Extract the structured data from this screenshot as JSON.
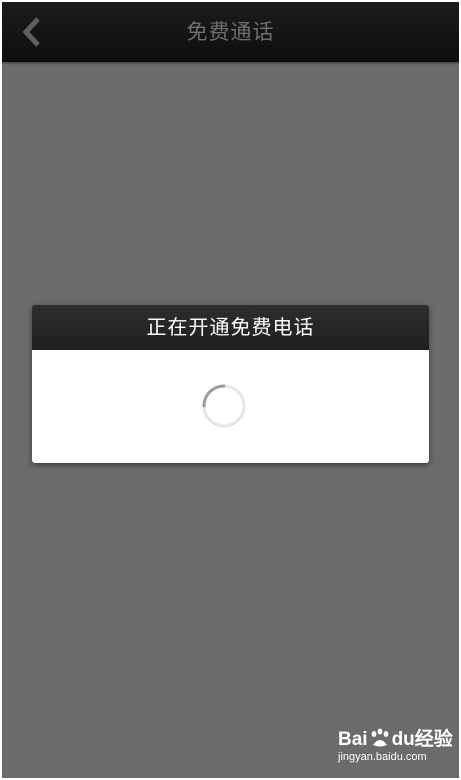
{
  "header": {
    "title": "免费通话",
    "back_icon": "chevron-left-icon"
  },
  "dialog": {
    "message": "正在开通免费电话",
    "spinner_icon": "loading-spinner-icon"
  },
  "watermark": {
    "brand_left": "Bai",
    "brand_mid": "du",
    "brand_right": "经验",
    "url": "jingyan.baidu.com"
  },
  "colors": {
    "background": "#6b6b6b",
    "topbar": "#111111",
    "title_text": "#6f6f6f",
    "dialog_header": "#262626",
    "dialog_body": "#ffffff"
  }
}
